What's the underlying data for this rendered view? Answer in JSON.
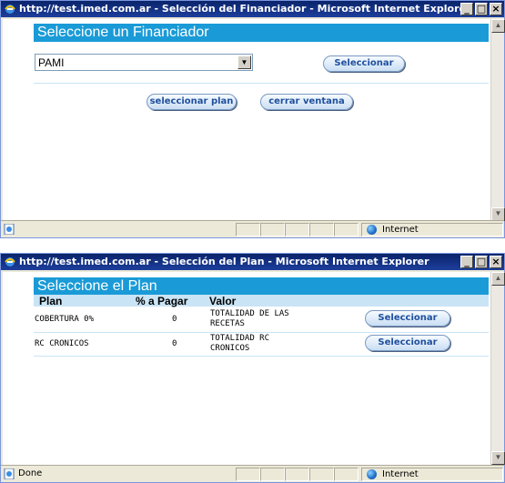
{
  "window1": {
    "title": "http://test.imed.com.ar - Selección del Financiador - Microsoft Internet Explorer",
    "heading": "Seleccione un Financiador",
    "select_value": "PAMI",
    "select_button": "Seleccionar",
    "plan_button": "seleccionar plan",
    "close_button": "cerrar ventana",
    "status_zone": "Internet"
  },
  "window2": {
    "title": "http://test.imed.com.ar - Selección del Plan - Microsoft Internet Explorer",
    "heading": "Seleccione el Plan",
    "columns": [
      "Plan",
      "% a Pagar",
      "Valor"
    ],
    "rows": [
      {
        "plan": "COBERTURA 0%",
        "pagar": "0",
        "valor_line1": "TOTALIDAD DE LAS",
        "valor_line2": "RECETAS",
        "button": "Seleccionar"
      },
      {
        "plan": "RC CRONICOS",
        "pagar": "0",
        "valor_line1": "TOTALIDAD RC",
        "valor_line2": "CRONICOS",
        "button": "Seleccionar"
      }
    ],
    "status_text": "Done",
    "status_zone": "Internet"
  },
  "title_buttons": {
    "minimize": "_",
    "maximize": "□",
    "close": "×"
  },
  "colors": {
    "accent_header": "#1a9bd7",
    "sub_header": "#c9e4f5",
    "titlebar": "#0a246a"
  }
}
